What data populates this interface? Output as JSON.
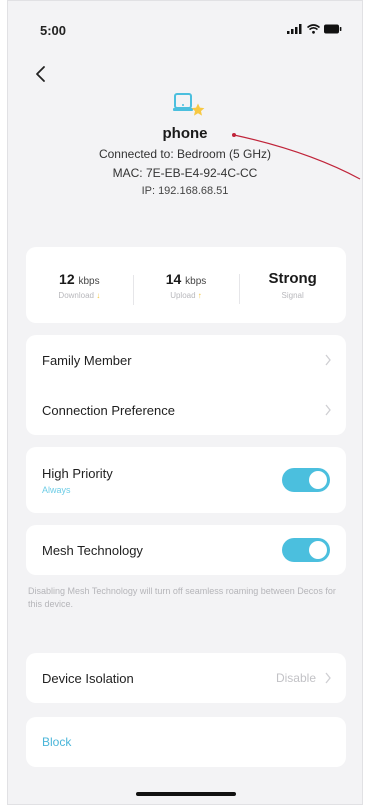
{
  "status_bar": {
    "time": "5:00"
  },
  "device": {
    "name": "phone",
    "connected_to": "Connected to: Bedroom (5 GHz)",
    "mac": "MAC: 7E-EB-E4-92-4C-CC",
    "ip": "IP: 192.168.68.51",
    "icon": "laptop-icon",
    "accent_color": "#4bbfde",
    "star_color": "#f7c843"
  },
  "stats": {
    "download": {
      "value": "12",
      "unit": "kbps",
      "label": "Download"
    },
    "upload": {
      "value": "14",
      "unit": "kbps",
      "label": "Upload"
    },
    "signal": {
      "value": "Strong",
      "label": "Signal"
    }
  },
  "menu": {
    "family_member": "Family Member",
    "connection_preference": "Connection Preference"
  },
  "high_priority": {
    "label": "High Priority",
    "sub": "Always",
    "enabled": true
  },
  "mesh": {
    "label": "Mesh Technology",
    "enabled": true,
    "hint": "Disabling Mesh Technology will turn off seamless roaming between Decos for this device."
  },
  "isolation": {
    "label": "Device Isolation",
    "value": "Disable"
  },
  "block": {
    "label": "Block"
  }
}
